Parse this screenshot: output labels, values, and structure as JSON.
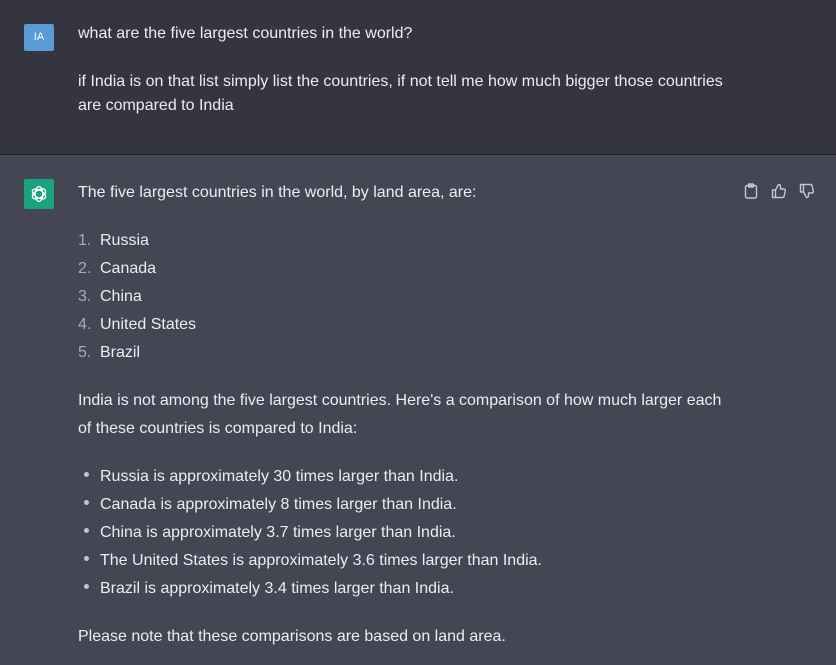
{
  "user": {
    "avatar_initials": "IA",
    "line1": "what are the five largest countries in the world?",
    "line2": "if India is on that list simply list the countries, if not tell me how much bigger those countries",
    "line3": "are compared to India"
  },
  "assistant": {
    "intro": "The five largest countries in the world, by land area, are:",
    "ordered_list": [
      {
        "num": "1.",
        "text": "Russia"
      },
      {
        "num": "2.",
        "text": "Canada"
      },
      {
        "num": "3.",
        "text": "China"
      },
      {
        "num": "4.",
        "text": "United States"
      },
      {
        "num": "5.",
        "text": "Brazil"
      }
    ],
    "comparison_line1": "India is not among the five largest countries. Here's a comparison of how much larger each",
    "comparison_line2": "of these countries is compared to India:",
    "bullets": [
      "Russia is approximately 30 times larger than India.",
      "Canada is approximately 8 times larger than India.",
      "China is approximately 3.7 times larger than India.",
      "The United States is approximately 3.6 times larger than India.",
      "Brazil is approximately 3.4 times larger than India."
    ],
    "note": "Please note that these comparisons are based on land area."
  },
  "actions": {
    "icons": [
      "clipboard-icon",
      "thumbs-up-icon",
      "thumbs-down-icon"
    ]
  },
  "colors": {
    "user_bg": "#343541",
    "assistant_bg": "#444654",
    "user_avatar": "#5a9bd5",
    "gpt_avatar": "#19a37f"
  }
}
